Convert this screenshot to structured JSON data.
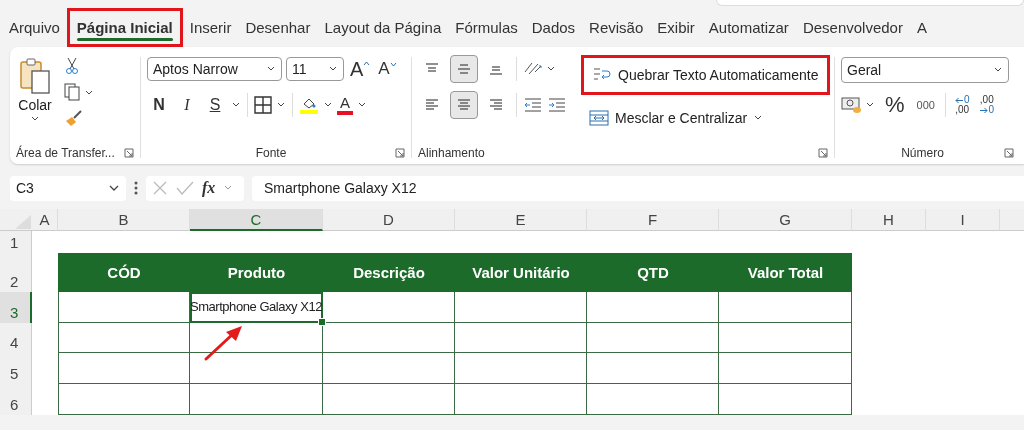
{
  "tabs": [
    {
      "label": "Arquivo",
      "selected": false,
      "highlighted": false
    },
    {
      "label": "Página Inicial",
      "selected": true,
      "highlighted": true
    },
    {
      "label": "Inserir",
      "selected": false,
      "highlighted": false
    },
    {
      "label": "Desenhar",
      "selected": false,
      "highlighted": false
    },
    {
      "label": "Layout da Página",
      "selected": false,
      "highlighted": false
    },
    {
      "label": "Fórmulas",
      "selected": false,
      "highlighted": false
    },
    {
      "label": "Dados",
      "selected": false,
      "highlighted": false
    },
    {
      "label": "Revisão",
      "selected": false,
      "highlighted": false
    },
    {
      "label": "Exibir",
      "selected": false,
      "highlighted": false
    },
    {
      "label": "Automatizar",
      "selected": false,
      "highlighted": false
    },
    {
      "label": "Desenvolvedor",
      "selected": false,
      "highlighted": false
    },
    {
      "label": "A",
      "selected": false,
      "highlighted": false
    }
  ],
  "clipboard": {
    "paste_label": "Colar",
    "group_label": "Área de Transfer..."
  },
  "font": {
    "name": "Aptos Narrow",
    "size": "11",
    "grow": "A",
    "shrink": "A",
    "style_buttons": [
      {
        "kind": "bold",
        "label": "N"
      },
      {
        "kind": "italic",
        "label": "I"
      },
      {
        "kind": "underline",
        "label": "S"
      }
    ],
    "font_color_label": "A",
    "group_label": "Fonte"
  },
  "alignment": {
    "vertical": [
      {
        "kind": "top",
        "selected": false
      },
      {
        "kind": "middle",
        "selected": true
      },
      {
        "kind": "bottom",
        "selected": false
      }
    ],
    "horizontal": [
      {
        "kind": "left",
        "selected": false
      },
      {
        "kind": "center",
        "selected": true
      },
      {
        "kind": "right",
        "selected": false
      }
    ],
    "wrap_text": {
      "label": "Quebrar Texto Automaticamente",
      "highlighted": true
    },
    "merge": {
      "label": "Mesclar e Centralizar"
    },
    "group_label": "Alinhamento"
  },
  "number": {
    "format": "Geral",
    "percent": "%",
    "thousands": "000",
    "increase_decimal": [
      "0",
      ",00"
    ],
    "decrease_decimal": [
      ",00",
      "0"
    ],
    "group_label": "Número"
  },
  "formula_bar": {
    "name_box": "C3",
    "fx": "fx",
    "formula": "Smartphone Galaxy X12"
  },
  "sheet": {
    "columns": [
      {
        "label": "A",
        "selected": false
      },
      {
        "label": "B",
        "selected": false
      },
      {
        "label": "C",
        "selected": true
      },
      {
        "label": "D",
        "selected": false
      },
      {
        "label": "E",
        "selected": false
      },
      {
        "label": "F",
        "selected": false
      },
      {
        "label": "G",
        "selected": false
      },
      {
        "label": "H",
        "selected": false
      },
      {
        "label": "I",
        "selected": false
      }
    ],
    "rows": [
      {
        "label": "1",
        "selected": false
      },
      {
        "label": "2",
        "selected": false
      },
      {
        "label": "3",
        "selected": true
      },
      {
        "label": "4",
        "selected": false
      },
      {
        "label": "5",
        "selected": false
      },
      {
        "label": "6",
        "selected": false
      }
    ],
    "arrow": true
  },
  "table": {
    "headers": [
      "CÓD",
      "Produto",
      "Descrição",
      "Valor Unitário",
      "QTD",
      "Valor Total"
    ],
    "rows": [
      [
        {
          "selected": false
        },
        {
          "value": "Smartphone Galaxy X12",
          "selected": true
        },
        {
          "selected": false
        },
        {
          "selected": false
        },
        {
          "selected": false
        },
        {
          "selected": false
        }
      ],
      [
        {
          "selected": false
        },
        {
          "selected": false
        },
        {
          "selected": false
        },
        {
          "selected": false
        },
        {
          "selected": false
        },
        {
          "selected": false
        }
      ],
      [
        {
          "selected": false
        },
        {
          "selected": false
        },
        {
          "selected": false
        },
        {
          "selected": false
        },
        {
          "selected": false
        },
        {
          "selected": false
        }
      ],
      [
        {
          "selected": false
        },
        {
          "selected": false
        },
        {
          "selected": false
        },
        {
          "selected": false
        },
        {
          "selected": false
        },
        {
          "selected": false
        }
      ]
    ]
  }
}
